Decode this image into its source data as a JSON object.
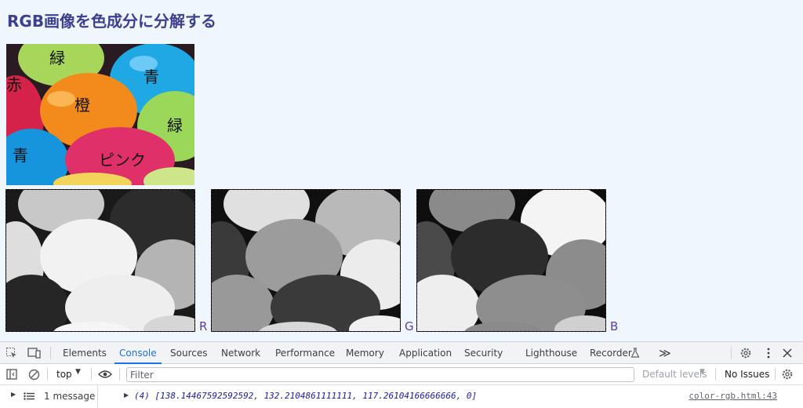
{
  "page": {
    "title": "RGB画像を色成分に分解する"
  },
  "photo": {
    "labels": {
      "aka": "赤",
      "midori_top": "緑",
      "ao_top": "青",
      "dai": "橙",
      "midori_right": "緑",
      "ao_bottom": "青",
      "pink": "ピンク"
    }
  },
  "channels": [
    {
      "letter": "R"
    },
    {
      "letter": "G"
    },
    {
      "letter": "B"
    }
  ],
  "devtools": {
    "tabs": [
      "Elements",
      "Console",
      "Sources",
      "Network",
      "Performance",
      "Memory",
      "Application",
      "Security",
      "Lighthouse",
      "Recorder"
    ],
    "active_tab": "Console",
    "overflow": "≫",
    "toolbar": {
      "context": "top",
      "filter_placeholder": "Filter",
      "levels": "Default levels",
      "issues": "No Issues"
    },
    "sidebar": {
      "messages": "1 message"
    },
    "console": {
      "output": "(4) [138.14467592592592, 132.2104861111111, 117.26104166666666, 0]",
      "source": "color-rgb.html:43"
    }
  },
  "colors": {
    "accent": "#1a73e8",
    "title": "#3b3f8f",
    "channel_letter": "#5b3cb0"
  }
}
